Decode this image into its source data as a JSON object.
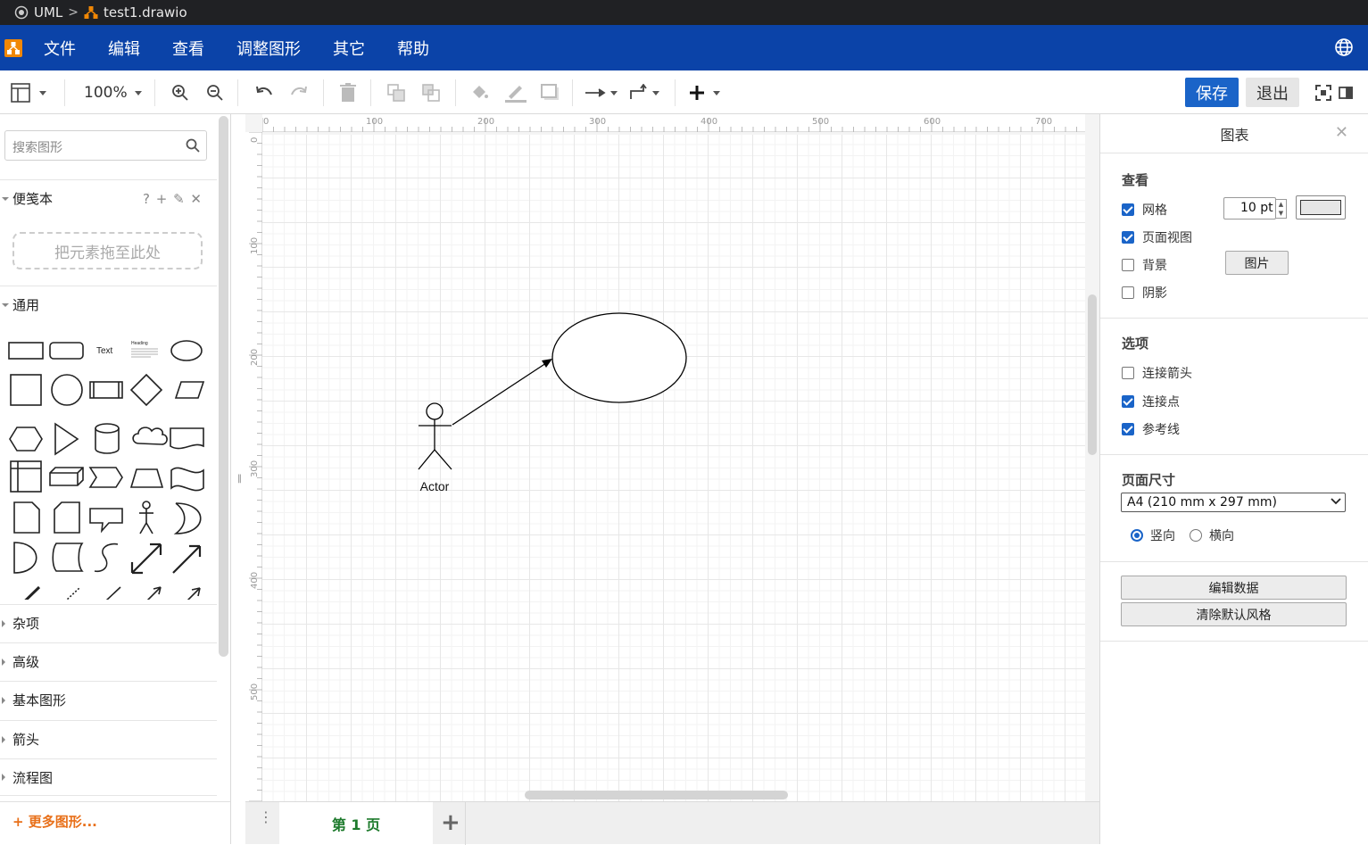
{
  "pathbar": {
    "root": "UML",
    "file": "test1.drawio"
  },
  "menu": {
    "items": [
      "文件",
      "编辑",
      "查看",
      "调整图形",
      "其它",
      "帮助"
    ]
  },
  "toolbar": {
    "zoom": "100%",
    "save_label": "保存",
    "exit_label": "退出"
  },
  "sidebar": {
    "search_placeholder": "搜索图形",
    "scratchpad_title": "便笺本",
    "scratchpad_actions": "? + ✎ ✕",
    "scratchpad_drop": "把元素拖至此处",
    "general_title": "通用",
    "text_shape": "Text",
    "heading_shape": "Heading",
    "sections": [
      "杂项",
      "高级",
      "基本图形",
      "箭头",
      "流程图"
    ],
    "more_shapes": "+ 更多图形..."
  },
  "canvas": {
    "ruler_top": [
      "0",
      "100",
      "200",
      "300",
      "400",
      "500",
      "600",
      "700"
    ],
    "ruler_left": [
      "0",
      "100",
      "200",
      "300",
      "400",
      "500"
    ],
    "actor_label": "Actor"
  },
  "pagebar": {
    "tab_label": "第 1 页",
    "add_label": "+"
  },
  "panel": {
    "title": "图表",
    "view_head": "查看",
    "grid_label": "网格",
    "grid_size": "10 pt",
    "page_view_label": "页面视图",
    "background_label": "背景",
    "image_btn": "图片",
    "shadow_label": "阴影",
    "options_head": "选项",
    "conn_arrows_label": "连接箭头",
    "conn_points_label": "连接点",
    "guides_label": "参考线",
    "page_size_head": "页面尺寸",
    "page_size_value": "A4 (210 mm x 297 mm)",
    "portrait_label": "竖向",
    "landscape_label": "横向",
    "edit_data_btn": "编辑数据",
    "clear_style_btn": "清除默认风格",
    "checks": {
      "grid": true,
      "page_view": true,
      "background": false,
      "shadow": false,
      "conn_arrows": false,
      "conn_points": true,
      "guides": true
    },
    "orientation": "portrait"
  },
  "colors": {
    "menubar": "#0b43a8",
    "accent": "#1a64c8",
    "more_shapes": "#e8701a",
    "page_tab": "#1d7a2c"
  }
}
